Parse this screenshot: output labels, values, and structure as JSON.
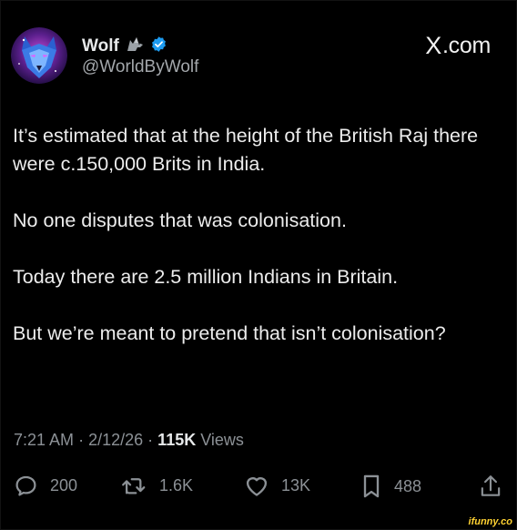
{
  "brand": {
    "name": "X",
    "domain": ".com"
  },
  "author": {
    "name": "Wolf",
    "handle": "@WorldByWolf",
    "avatar_icon": "wolf-avatar",
    "name_emoji_icon": "wolf-emoji-icon",
    "verified_icon": "verified-badge-icon"
  },
  "post": {
    "paragraphs": [
      "It’s estimated that at the height of the British Raj there were c.150,000 Brits in India.",
      "No one disputes that was colonisation.",
      "Today there are 2.5 million Indians in Britain.",
      "But we’re meant to pretend that isn’t colonisation?"
    ],
    "time": "7:21 AM",
    "separator": "·",
    "date": "2/12/26",
    "views_count": "115K",
    "views_label": "Views"
  },
  "actions": {
    "replies": "200",
    "reposts": "1.6K",
    "likes": "13K",
    "bookmarks": "488"
  },
  "watermark": "ifunny.co",
  "colors": {
    "background": "#000000",
    "text": "#e7e9ea",
    "muted": "#8c9196",
    "verified": "#1d9bf0",
    "watermark": "#ffd232"
  }
}
